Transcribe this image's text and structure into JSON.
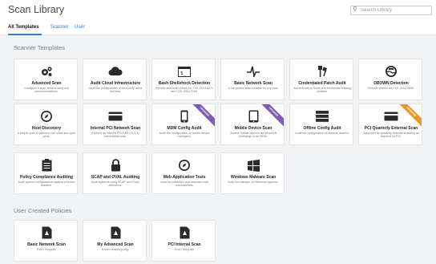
{
  "header": {
    "title": "Scan Library"
  },
  "search": {
    "placeholder": "Search Library"
  },
  "tabs": [
    {
      "label": "All Templates",
      "active": true
    },
    {
      "label": "Scanner",
      "active": false
    },
    {
      "label": "User",
      "active": false
    }
  ],
  "sections": {
    "scanner": "Scanner Templates",
    "user": "User Created Policies"
  },
  "colors": {
    "accent": "#3a7bc8",
    "upgrade_purple": "#7b5db3",
    "upgrade_orange": "#e79a32"
  },
  "scanner_templates": [
    {
      "title": "Advanced Scan",
      "desc": "Configure a scan without using any recommendations.",
      "icon": "gears-icon"
    },
    {
      "title": "Audit Cloud Infrastructure",
      "desc": "Audit the configuration of third-party cloud services.",
      "icon": "cloud-icon"
    },
    {
      "title": "Bash Shellshock Detection",
      "desc": "Remote and local checks for CVE-2014-6271 and CVE-2014-7169.",
      "icon": "terminal-icon"
    },
    {
      "title": "Basic Network Scan",
      "desc": "A full system scan suitable for any host.",
      "icon": "pulse-icon"
    },
    {
      "title": "Credentialed Patch Audit",
      "desc": "Authenticate to hosts and enumerate missing updates.",
      "icon": "keys-icon"
    },
    {
      "title": "DROWN Detection",
      "desc": "Remote checks for CVE-2016-0800.",
      "icon": "drown-icon"
    },
    {
      "title": "Host Discovery",
      "desc": "A simple scan to discover live hosts and open ports.",
      "icon": "compass-icon"
    },
    {
      "title": "Internal PCI Network Scan",
      "desc": "Perform an internal PCI DSS (11.2.1) vulnerability scan.",
      "icon": "credit-card-icon"
    },
    {
      "title": "MDM Config Audit",
      "desc": "Audit the configuration of mobile device managers.",
      "icon": "mobile-icon",
      "ribbon": "UPGRADE",
      "ribbon_color": "purple"
    },
    {
      "title": "Mobile Device Scan",
      "desc": "Assess mobile devices via Microsoft Exchange or an MDM.",
      "icon": "tablet-icon",
      "ribbon": "UPGRADE",
      "ribbon_color": "purple"
    },
    {
      "title": "Offline Config Audit",
      "desc": "Audit the configuration of network devices.",
      "icon": "server-icon"
    },
    {
      "title": "PCI Quarterly External Scan",
      "desc": "Approved for quarterly external scanning as required by PCI.",
      "icon": "credit-card-icon",
      "ribbon": "UPGRADE",
      "ribbon_color": "orange"
    },
    {
      "title": "Policy Compliance Auditing",
      "desc": "Audit system configurations against a known baseline.",
      "icon": "clipboard-icon"
    },
    {
      "title": "SCAP and OVAL Auditing",
      "desc": "Audit systems using SCAP and OVAL definitions.",
      "icon": "lock-icon"
    },
    {
      "title": "Web Application Tests",
      "desc": "Scan for published and unknown web vulnerabilities.",
      "icon": "compass-icon"
    },
    {
      "title": "Windows Malware Scan",
      "desc": "Scan for malware on Windows systems.",
      "icon": "windows-icon"
    }
  ],
  "user_policies": [
    {
      "title": "Basic Network Scan",
      "desc": "From Template",
      "icon": "document-icon"
    },
    {
      "title": "My Advanced Scan",
      "desc": "A user created policy.",
      "icon": "document-icon"
    },
    {
      "title": "PCI Internal Scan",
      "desc": "From Template",
      "icon": "document-icon"
    }
  ]
}
